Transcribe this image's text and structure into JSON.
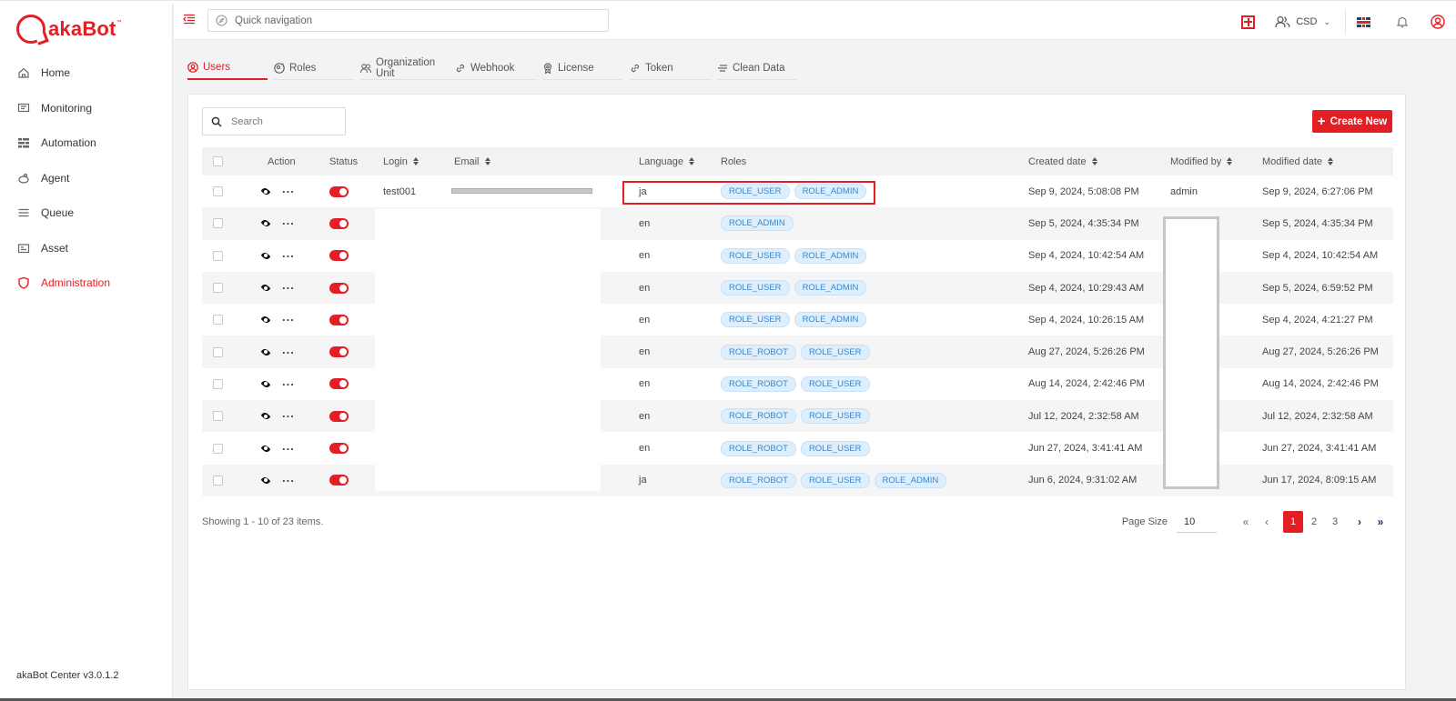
{
  "brand": {
    "name_aka": "aka",
    "name_bot": "Bot",
    "tm": "™",
    "version": "akaBot Center v3.0.1.2"
  },
  "sidebar": {
    "items": [
      {
        "label": "Home",
        "icon": "home-icon"
      },
      {
        "label": "Monitoring",
        "icon": "monitor-icon"
      },
      {
        "label": "Automation",
        "icon": "automation-icon"
      },
      {
        "label": "Agent",
        "icon": "agent-icon"
      },
      {
        "label": "Queue",
        "icon": "queue-icon"
      },
      {
        "label": "Asset",
        "icon": "asset-icon"
      },
      {
        "label": "Administration",
        "icon": "shield-icon",
        "active": true
      }
    ]
  },
  "header": {
    "quicknav_placeholder": "Quick navigation",
    "tenant": "CSD"
  },
  "tabs": [
    {
      "label": "Users",
      "active": true
    },
    {
      "label": "Roles"
    },
    {
      "label": "Organization Unit"
    },
    {
      "label": "Webhook"
    },
    {
      "label": "License"
    },
    {
      "label": "Token"
    },
    {
      "label": "Clean Data"
    }
  ],
  "toolbar": {
    "search_placeholder": "Search",
    "create_label": "Create New"
  },
  "table": {
    "headers": {
      "action": "Action",
      "status": "Status",
      "login": "Login",
      "email": "Email",
      "language": "Language",
      "roles": "Roles",
      "created": "Created date",
      "modified_by": "Modified by",
      "modified": "Modified date"
    },
    "rows": [
      {
        "login": "test001",
        "language": "ja",
        "roles": [
          "ROLE_USER",
          "ROLE_ADMIN"
        ],
        "created": "Sep 9, 2024, 5:08:08 PM",
        "modified_by": "admin",
        "modified": "Sep 9, 2024, 6:27:06 PM"
      },
      {
        "login": "",
        "language": "en",
        "roles": [
          "ROLE_ADMIN"
        ],
        "created": "Sep 5, 2024, 4:35:34 PM",
        "modified_by": "",
        "modified": "Sep 5, 2024, 4:35:34 PM"
      },
      {
        "login": "",
        "language": "en",
        "roles": [
          "ROLE_USER",
          "ROLE_ADMIN"
        ],
        "created": "Sep 4, 2024, 10:42:54 AM",
        "modified_by": "",
        "modified": "Sep 4, 2024, 10:42:54 AM"
      },
      {
        "login": "",
        "language": "en",
        "roles": [
          "ROLE_USER",
          "ROLE_ADMIN"
        ],
        "created": "Sep 4, 2024, 10:29:43 AM",
        "modified_by": "",
        "modified": "Sep 5, 2024, 6:59:52 PM"
      },
      {
        "login": "",
        "language": "en",
        "roles": [
          "ROLE_USER",
          "ROLE_ADMIN"
        ],
        "created": "Sep 4, 2024, 10:26:15 AM",
        "modified_by": "",
        "modified": "Sep 4, 2024, 4:21:27 PM"
      },
      {
        "login": "",
        "language": "en",
        "roles": [
          "ROLE_ROBOT",
          "ROLE_USER"
        ],
        "created": "Aug 27, 2024, 5:26:26 PM",
        "modified_by": "",
        "modified": "Aug 27, 2024, 5:26:26 PM"
      },
      {
        "login": "",
        "language": "en",
        "roles": [
          "ROLE_ROBOT",
          "ROLE_USER"
        ],
        "created": "Aug 14, 2024, 2:42:46 PM",
        "modified_by": "",
        "modified": "Aug 14, 2024, 2:42:46 PM"
      },
      {
        "login": "",
        "language": "en",
        "roles": [
          "ROLE_ROBOT",
          "ROLE_USER"
        ],
        "created": "Jul 12, 2024, 2:32:58 AM",
        "modified_by": "",
        "modified": "Jul 12, 2024, 2:32:58 AM"
      },
      {
        "login": "",
        "language": "en",
        "roles": [
          "ROLE_ROBOT",
          "ROLE_USER"
        ],
        "created": "Jun 27, 2024, 3:41:41 AM",
        "modified_by": "",
        "modified": "Jun 27, 2024, 3:41:41 AM"
      },
      {
        "login": "",
        "language": "ja",
        "roles": [
          "ROLE_ROBOT",
          "ROLE_USER",
          "ROLE_ADMIN"
        ],
        "created": "Jun 6, 2024, 9:31:02 AM",
        "modified_by": "",
        "modified": "Jun 17, 2024, 8:09:15 AM"
      }
    ]
  },
  "footer": {
    "showing": "Showing 1 - 10 of 23 items.",
    "page_size_label": "Page Size",
    "page_size": "10",
    "pages": [
      "1",
      "2",
      "3"
    ],
    "current_page": "1"
  },
  "colors": {
    "accent": "#e31e24",
    "tag_bg": "#ddeefd",
    "tag_text": "#3b87c9"
  }
}
